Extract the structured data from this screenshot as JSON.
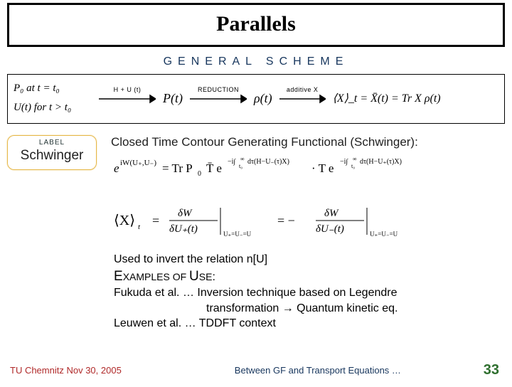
{
  "title": "Parallels",
  "general_scheme": "GENERAL  SCHEME",
  "diagram": {
    "p0_at_t0": "P₀ at t = t₀",
    "Ut_for_t_gt_t0": "U(t) for t > t₀",
    "hu_label": "H + U (t)",
    "reduction_label": "REDUCTION",
    "additive_label": "additive X",
    "Pt": "P(t)",
    "rho_t": "ρ(t)",
    "Xt_eq": "⟨X⟩_t = X̄(t) = Tr X ρ(t)"
  },
  "label_box": {
    "small": "LABEL",
    "big": "Schwinger"
  },
  "section_title": "Closed Time Contour Generating Functional (Schwinger):",
  "formulas": {
    "eiW": "e^{ iW(U₊,U₋) } = Tr P₀ T̄ e^{ −i ∫_{t₀}^{∞} dτ (H − U₋(τ) X) } · T e^{ −i ∫_{t₀}^{∞} dτ (H − U₊(τ) X) }",
    "Xt": "⟨X⟩_t  =  δW / δU₊(t) |_{U₊=U₋=U}  =  − δW / δU₋(t) |_{U₊=U₋=U}"
  },
  "lower": {
    "invert_line": "Used to invert the relation   n[U]",
    "examples_head": "Examples of Use:",
    "fukuda1": "Fukuda et al. … Inversion technique based on Legendre",
    "fukuda2": "transformation → Quantum kinetic eq.",
    "leuwen": "Leuwen et al. … TDDFT context"
  },
  "footer": {
    "venue": "TU Chemnitz Nov 30, 2005",
    "mid": "Between GF and Transport Equations …",
    "page": "33"
  }
}
